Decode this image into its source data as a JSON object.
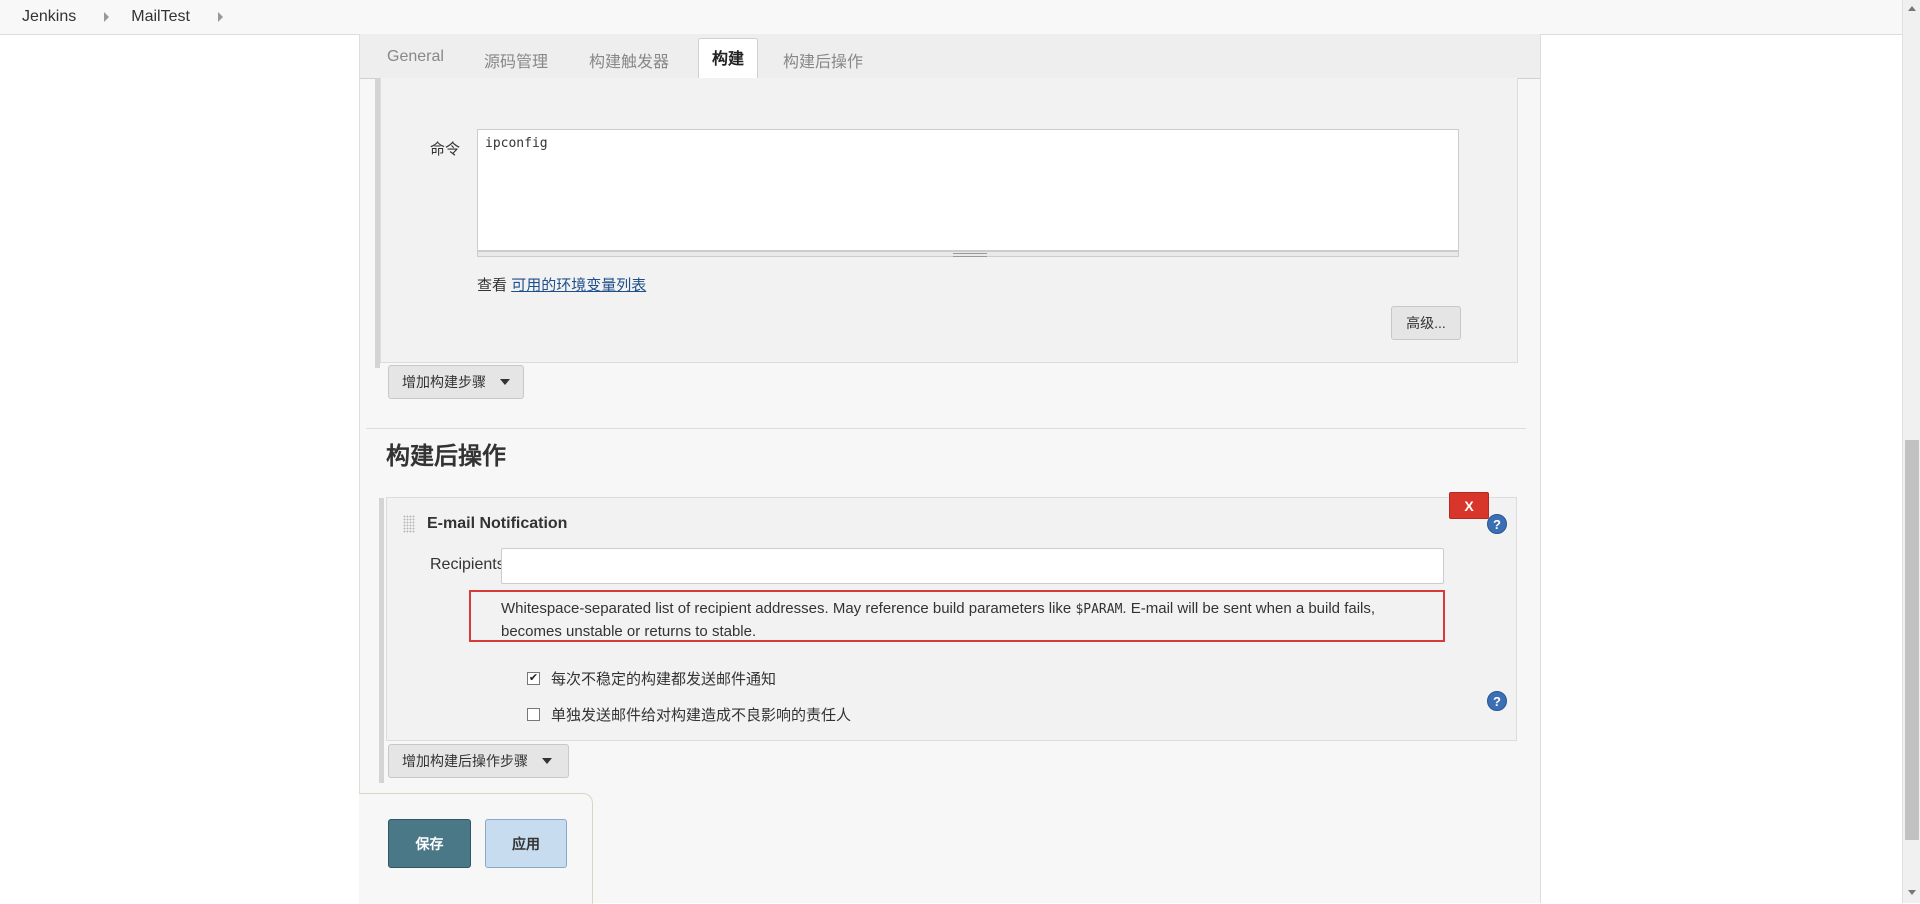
{
  "breadcrumb": {
    "items": [
      "Jenkins",
      "MailTest"
    ]
  },
  "tabs": [
    "General",
    "源码管理",
    "构建触发器",
    "构建",
    "构建后操作"
  ],
  "build": {
    "command_label": "命令",
    "command_value": "ipconfig",
    "env_prefix": "查看",
    "env_link": "可用的环境变量列表",
    "advanced_button": "高级...",
    "add_step_button": "增加构建步骤"
  },
  "post_build": {
    "section_title": "构建后操作",
    "email": {
      "title": "E-mail Notification",
      "delete_label": "X",
      "recipients_label": "Recipients",
      "recipients_value": "",
      "help_part1": "Whitespace-separated list of recipient addresses. May reference build parameters like ",
      "help_code": "$PARAM",
      "help_part2": ". E-mail will be sent when a build fails, becomes unstable or returns to stable.",
      "checkbox1_label": "每次不稳定的构建都发送邮件通知",
      "checkbox1_checked": true,
      "checkbox2_label": "单独发送邮件给对构建造成不良影响的责任人",
      "checkbox2_checked": false
    },
    "add_post_step_button": "增加构建后操作步骤"
  },
  "footer": {
    "save_button": "保存",
    "apply_button": "应用"
  },
  "icons": {
    "help": "help-icon",
    "caret": "caret-down-icon",
    "breadcrumb_arrow": "chevron-right-icon"
  },
  "colors": {
    "delete": "#d9362b",
    "save": "#4a7886",
    "apply": "#c8dcf0",
    "link": "#1f4e8c",
    "help": "#3c6eb4",
    "highlight_box": "#d63a3a"
  }
}
